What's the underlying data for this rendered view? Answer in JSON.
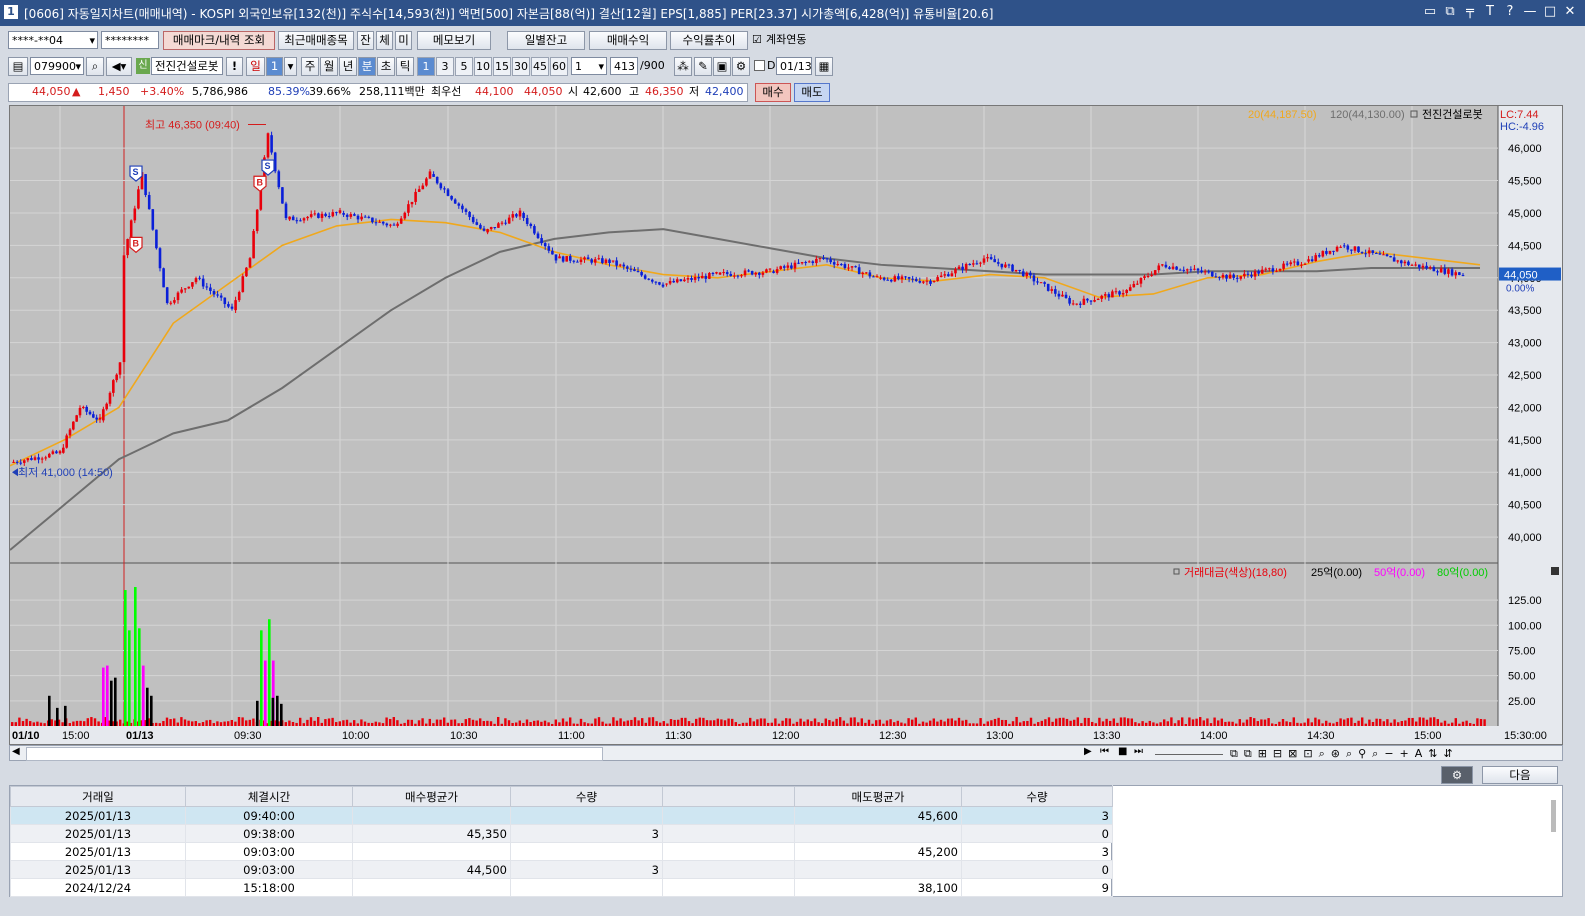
{
  "window": {
    "number": "1",
    "title": "[0606] 자동일지차트(매매내역) - KOSPI 외국인보유[132(천)] 주식수[14,593(천)] 액면[500] 자본금[88(억)] 결산[12월] EPS[1,885] PER[23.37] 시가총액[6,428(억)] 유통비율[20.6]",
    "controls": [
      "▭",
      "⧉",
      "╤",
      "T",
      "?",
      "—",
      "□",
      "✕"
    ]
  },
  "toolbar1": {
    "account": "****-**04",
    "password": "********",
    "buttons": [
      "매매마크/내역 조회",
      "최근매매종목",
      "잔",
      "체",
      "미",
      "메모보기"
    ],
    "right_buttons": [
      "일별잔고",
      "매매수익",
      "수익률추이"
    ],
    "link_label": "계좌연동",
    "link_checked": "☑"
  },
  "toolbar2": {
    "code": "079900",
    "credit_badge": "신",
    "name": "전진건설로봇",
    "warn": "!",
    "periods": [
      "일",
      "1",
      "주",
      "월",
      "년",
      "분",
      "초",
      "틱"
    ],
    "minutes": [
      "1",
      "3",
      "5",
      "10",
      "15",
      "30",
      "45",
      "60"
    ],
    "count_select": "1",
    "count": "413",
    "count_total": "/900",
    "date": "01/13",
    "date_prefix": "D"
  },
  "quote": {
    "price": "44,050",
    "arrow": "▲",
    "change": "1,450",
    "change_pct": "+3.40%",
    "volume": "5,786,986",
    "ratio1": "85.39%",
    "ratio2": "39.66%",
    "amount": "258,111백만",
    "best_label": "최우선",
    "ask": "44,100",
    "bid": "44,050",
    "open_label": "시",
    "open": "42,600",
    "high_label": "고",
    "high": "46,350",
    "low_label": "저",
    "low": "42,400",
    "buy_btn": "매수",
    "sell_btn": "매도"
  },
  "chart_data": {
    "type": "candlestick",
    "title": "전진건설로봇",
    "legend": {
      "ma20": "20(44,187.50)",
      "ma120": "120(44,130.00)",
      "stock": "전진건설로봇"
    },
    "lc": "LC:7.44",
    "hc": "HC:-4.96",
    "high_note": "최고 46,350 (09:40)",
    "low_note": "최저 41,000 (14:50)",
    "current_price": "44,050",
    "current_pct": "0.00%",
    "y_ticks": [
      "46,000",
      "45,500",
      "45,000",
      "44,500",
      "44,000",
      "43,500",
      "43,000",
      "42,500",
      "42,000",
      "41,500",
      "41,000",
      "40,500",
      "40,000"
    ],
    "y_tick_values": [
      46000,
      45500,
      45000,
      44500,
      44000,
      43500,
      43000,
      42500,
      42000,
      41500,
      41000,
      40500,
      40000
    ],
    "ylim": [
      39600,
      46650
    ],
    "x_labels": [
      "01/10",
      "15:00",
      "01/13",
      "09:30",
      "10:00",
      "10:30",
      "11:00",
      "11:30",
      "12:00",
      "12:30",
      "13:00",
      "13:30",
      "14:00",
      "14:30",
      "15:00"
    ],
    "x_axis_right": "15:30:00",
    "trade_marks": [
      {
        "label": "S",
        "time": "09:03",
        "price": 45600
      },
      {
        "label": "B",
        "time": "09:03",
        "price": 44500
      },
      {
        "label": "S",
        "time": "09:40",
        "price": 45600
      },
      {
        "label": "B",
        "time": "09:38",
        "price": 45350
      }
    ],
    "price_path": [
      {
        "t": "14:50",
        "p": 41150
      },
      {
        "t": "15:00",
        "p": 41300
      },
      {
        "t": "15:10",
        "p": 42000
      },
      {
        "t": "15:20",
        "p": 41800
      },
      {
        "t": "15:30",
        "p": 42700
      },
      {
        "t": "09:00",
        "p": 44350
      },
      {
        "t": "09:05",
        "p": 45600
      },
      {
        "t": "09:12",
        "p": 43600
      },
      {
        "t": "09:20",
        "p": 44000
      },
      {
        "t": "09:30",
        "p": 43500
      },
      {
        "t": "09:35",
        "p": 44300
      },
      {
        "t": "09:40",
        "p": 46200
      },
      {
        "t": "09:45",
        "p": 44900
      },
      {
        "t": "10:00",
        "p": 45000
      },
      {
        "t": "10:15",
        "p": 44800
      },
      {
        "t": "10:25",
        "p": 45600
      },
      {
        "t": "10:40",
        "p": 44700
      },
      {
        "t": "10:50",
        "p": 45000
      },
      {
        "t": "11:00",
        "p": 44300
      },
      {
        "t": "11:15",
        "p": 44250
      },
      {
        "t": "11:30",
        "p": 43900
      },
      {
        "t": "11:45",
        "p": 44050
      },
      {
        "t": "12:00",
        "p": 44100
      },
      {
        "t": "12:15",
        "p": 44300
      },
      {
        "t": "12:30",
        "p": 44000
      },
      {
        "t": "12:45",
        "p": 43950
      },
      {
        "t": "13:00",
        "p": 44300
      },
      {
        "t": "13:10",
        "p": 44100
      },
      {
        "t": "13:25",
        "p": 43600
      },
      {
        "t": "13:40",
        "p": 43800
      },
      {
        "t": "13:50",
        "p": 44200
      },
      {
        "t": "14:10",
        "p": 44000
      },
      {
        "t": "14:30",
        "p": 44250
      },
      {
        "t": "14:40",
        "p": 44500
      },
      {
        "t": "15:00",
        "p": 44200
      },
      {
        "t": "15:15",
        "p": 44050
      }
    ],
    "ma20": [
      41100,
      41500,
      42000,
      43300,
      43900,
      44500,
      44800,
      44900,
      44850,
      44700,
      44400,
      44200,
      44050,
      44000,
      44100,
      44200,
      44000,
      43950,
      44050,
      44000,
      43700,
      43750,
      44000,
      44050,
      44250,
      44400,
      44300,
      44200
    ],
    "ma120": [
      39800,
      40500,
      41200,
      41600,
      41800,
      42300,
      42900,
      43500,
      44000,
      44400,
      44600,
      44700,
      44750,
      44600,
      44450,
      44300,
      44200,
      44150,
      44100,
      44050,
      44050,
      44050,
      44100,
      44100,
      44100,
      44150,
      44150,
      44150
    ],
    "volume_panel": {
      "legend": "거래대금(색상)(18,80)",
      "legend_25": "25억(0.00)",
      "legend_50": "50억(0.00)",
      "legend_80": "80억(0.00)",
      "y_ticks": [
        "125.00",
        "100.00",
        "75.00",
        "50.00",
        "25.00"
      ],
      "y_tick_values": [
        125,
        100,
        75,
        50,
        25
      ],
      "ylim": [
        0,
        140
      ],
      "colors": {
        "base": "#e8000b",
        "over25": "#000000",
        "over50": "#ff00ff",
        "over80": "#00ff00"
      },
      "bars": [
        {
          "t": "15:20",
          "v": 30,
          "c": "over25"
        },
        {
          "t": "15:30",
          "v": 18,
          "c": "over25"
        },
        {
          "t": "15:35",
          "v": 20,
          "c": "over25"
        },
        {
          "t": "15:40",
          "v": 58,
          "c": "over50"
        },
        {
          "t": "15:45",
          "v": 60,
          "c": "over50"
        },
        {
          "t": "15:48",
          "v": 45,
          "c": "over25"
        },
        {
          "t": "15:50",
          "v": 48,
          "c": "over25"
        },
        {
          "t": "09:00",
          "v": 135,
          "c": "over80"
        },
        {
          "t": "09:02",
          "v": 95,
          "c": "over80"
        },
        {
          "t": "09:03",
          "v": 138,
          "c": "over80"
        },
        {
          "t": "09:04",
          "v": 97,
          "c": "over80"
        },
        {
          "t": "09:05",
          "v": 60,
          "c": "over50"
        },
        {
          "t": "09:06",
          "v": 38,
          "c": "over25"
        },
        {
          "t": "09:07",
          "v": 30,
          "c": "over25"
        },
        {
          "t": "09:10",
          "v": 25,
          "c": "over25"
        },
        {
          "t": "09:35",
          "v": 95,
          "c": "over80"
        },
        {
          "t": "09:36",
          "v": 65,
          "c": "over50"
        },
        {
          "t": "09:37",
          "v": 106,
          "c": "over80"
        },
        {
          "t": "09:38",
          "v": 65,
          "c": "over50"
        },
        {
          "t": "09:39",
          "v": 30,
          "c": "over25"
        },
        {
          "t": "09:40",
          "v": 22,
          "c": "over25"
        },
        {
          "t": "09:41",
          "v": 28,
          "c": "over25"
        }
      ]
    }
  },
  "nav_icons": [
    "▶",
    "⏮",
    "■",
    "⏭"
  ],
  "grid_panel": {
    "settings_btn": "⚙",
    "next_btn": "다음",
    "columns": [
      "거래일",
      "체결시간",
      "매수평균가",
      "수량",
      "",
      "매도평균가",
      "수량"
    ],
    "rows": [
      [
        "2025/01/13",
        "09:40:00",
        "",
        "",
        "",
        "45,600",
        "3"
      ],
      [
        "2025/01/13",
        "09:38:00",
        "45,350",
        "3",
        "",
        "",
        "0"
      ],
      [
        "2025/01/13",
        "09:03:00",
        "",
        "",
        "",
        "45,200",
        "3"
      ],
      [
        "2025/01/13",
        "09:03:00",
        "44,500",
        "3",
        "",
        "",
        "0"
      ],
      [
        "2024/12/24",
        "15:18:00",
        "",
        "",
        "",
        "38,100",
        "9"
      ]
    ]
  }
}
